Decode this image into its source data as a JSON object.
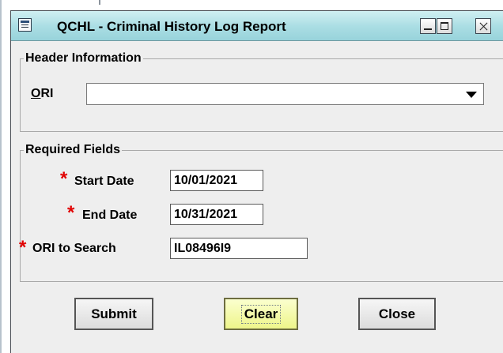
{
  "window": {
    "title": "QCHL - Criminal History Log Report"
  },
  "header_section": {
    "legend": "Header Information",
    "ori": {
      "label_mnemonic": "O",
      "label_rest": "RI",
      "value": ""
    }
  },
  "required_section": {
    "legend": "Required Fields",
    "required_marker": "*",
    "start_date": {
      "label": "Start Date",
      "value": "10/01/2021"
    },
    "end_date": {
      "label": "End Date",
      "value": "10/31/2021"
    },
    "ori_to_search": {
      "label": "ORI to Search",
      "value": "IL08496I9"
    }
  },
  "buttons": {
    "submit": "Submit",
    "clear": "Clear",
    "close": "Close"
  },
  "colors": {
    "titlebar": "#a9dde3",
    "required_marker": "#e10000",
    "focused_button": "#eef58a"
  },
  "icons": {
    "window_icon": "window-menu-icon",
    "minimize": "minimize-icon",
    "maximize": "maximize-icon",
    "close": "close-icon",
    "dropdown": "chevron-down-icon"
  }
}
